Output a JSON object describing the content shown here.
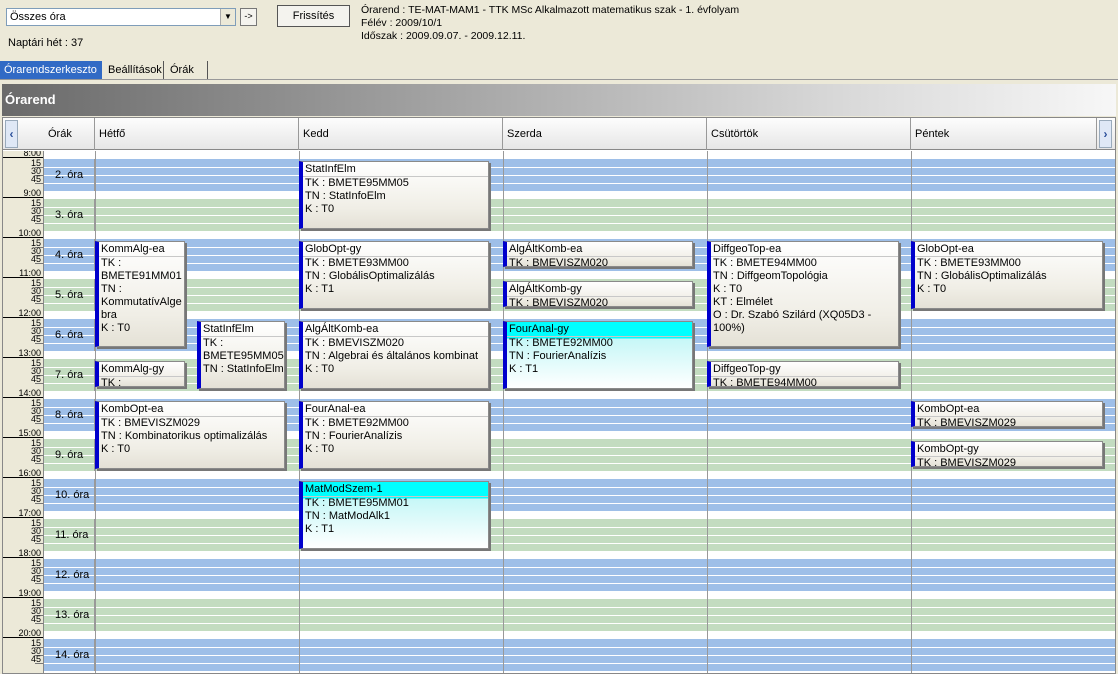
{
  "toolbar": {
    "combo_value": "Összes óra",
    "go_label": "->",
    "refresh_label": "Frissítés",
    "week_label": "Naptári hét : 37",
    "info_line1": "Órarend : TE-MAT-MAM1 - TTK MSc Alkalmazott matematikus szak - 1. évfolyam",
    "info_line2": "Félév : 2009/10/1",
    "info_line3": "Időszak : 2009.09.07. - 2009.12.11."
  },
  "tabs": [
    "Órarendszerkeszto",
    "Beállítások",
    "Órák"
  ],
  "banner_title": "Órarend",
  "columns": {
    "nav_prev": "‹",
    "nav_next": "›",
    "hours": "Órák",
    "days": [
      "Hétfő",
      "Kedd",
      "Szerda",
      "Csütörtök",
      "Péntek"
    ]
  },
  "times": [
    "8:00",
    "9:00",
    "10:00",
    "11:00",
    "12:00",
    "13:00",
    "14:00",
    "15:00",
    "16:00",
    "17:00",
    "18:00",
    "19:00",
    "20:00"
  ],
  "quarters": [
    "15",
    "30",
    "45"
  ],
  "periods": [
    "2. óra",
    "3. óra",
    "4. óra",
    "5. óra",
    "6. óra",
    "7. óra",
    "8. óra",
    "9. óra",
    "10. óra",
    "11. óra",
    "12. óra",
    "13. óra",
    "14. óra"
  ],
  "events": [
    {
      "title": "StatInfElm",
      "lines": [
        "TK : BMETE95MM05",
        "TN : StatInfoElm",
        "K : T0"
      ]
    },
    {
      "title": "KommAlg-ea",
      "lines": [
        "TK :",
        "BMETE91MM01",
        "TN :",
        "KommutatívAlge",
        "bra",
        "K : T0"
      ]
    },
    {
      "title": "GlobOpt-gy",
      "lines": [
        "TK : BMETE93MM00",
        "TN : GlobálisOptimalizálás",
        "K : T1"
      ]
    },
    {
      "title": "AlgÁltKomb-ea",
      "lines": [
        "TK : BMEVISZM020"
      ]
    },
    {
      "title": "DiffgeoTop-ea",
      "lines": [
        "TK : BMETE94MM00",
        "TN : DiffgeomTopológia",
        "K : T0",
        "KT : Elmélet",
        "O : Dr. Szabó Szilárd (XQ05D3 -",
        "100%)"
      ]
    },
    {
      "title": "GlobOpt-ea",
      "lines": [
        "TK : BMETE93MM00",
        "TN : GlobálisOptimalizálás",
        "K : T0"
      ]
    },
    {
      "title": "AlgÁltKomb-gy",
      "lines": [
        "TK : BMEVISZM020"
      ]
    },
    {
      "title": "StatInfElm",
      "lines": [
        "TK :",
        "BMETE95MM05",
        "TN : StatInfoElm"
      ]
    },
    {
      "title": "AlgÁltKomb-ea",
      "lines": [
        "TK : BMEVISZM020",
        "TN : Algebrai és általános kombinat",
        "K : T0"
      ]
    },
    {
      "title": "FourAnal-gy",
      "lines": [
        "TK : BMETE92MM00",
        "TN : FourierAnalízis",
        "K : T1"
      ]
    },
    {
      "title": "KommAlg-gy",
      "lines": [
        "TK :"
      ]
    },
    {
      "title": "DiffgeoTop-gy",
      "lines": [
        "TK : BMETE94MM00"
      ]
    },
    {
      "title": "KombOpt-ea",
      "lines": [
        "TK : BMEVISZM029",
        "TN : Kombinatorikus optimalizálás",
        "K : T0"
      ]
    },
    {
      "title": "FourAnal-ea",
      "lines": [
        "TK : BMETE92MM00",
        "TN : FourierAnalízis",
        "K : T0"
      ]
    },
    {
      "title": "KombOpt-ea",
      "lines": [
        "TK : BMEVISZM029"
      ]
    },
    {
      "title": "KombOpt-gy",
      "lines": [
        "TK : BMEVISZM029"
      ]
    },
    {
      "title": "MatModSzem-1",
      "lines": [
        "TK : BMETE95MM01",
        "TN : MatModAlk1",
        "K : T1"
      ]
    }
  ],
  "colors": {
    "band_blue": "#9ebfe8",
    "band_green": "#c3dcc0",
    "accent": "#0000cc",
    "highlight": "#00ffff",
    "tab_active": "#316ac5"
  }
}
